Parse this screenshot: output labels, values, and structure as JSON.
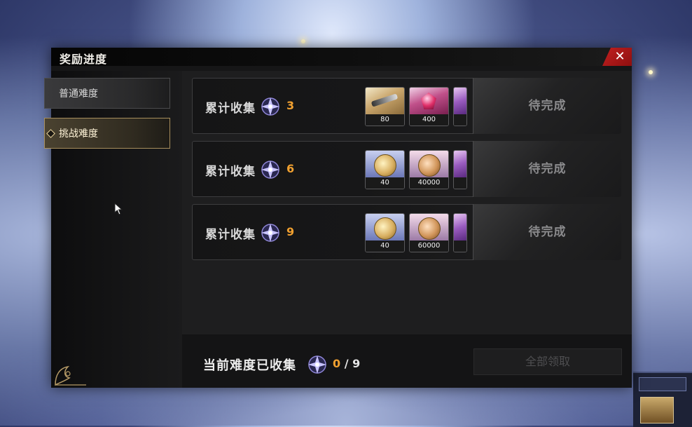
{
  "panel": {
    "title": "奖励进度",
    "close_label": "✕"
  },
  "sidebar": {
    "items": [
      {
        "label": "普通难度",
        "active": false
      },
      {
        "label": "挑战难度",
        "active": true
      }
    ]
  },
  "rows": [
    {
      "label": "累计收集",
      "count": "3",
      "items": [
        {
          "qty": "80",
          "icon": "sword"
        },
        {
          "qty": "400",
          "icon": "gem"
        },
        {
          "qty": "",
          "icon": "purple-item"
        }
      ],
      "status": "待完成"
    },
    {
      "label": "累计收集",
      "count": "6",
      "items": [
        {
          "qty": "40",
          "icon": "gold-coin"
        },
        {
          "qty": "40000",
          "icon": "copper-coin"
        },
        {
          "qty": "",
          "icon": "purple-item"
        }
      ],
      "status": "待完成"
    },
    {
      "label": "累计收集",
      "count": "9",
      "items": [
        {
          "qty": "40",
          "icon": "gold-coin"
        },
        {
          "qty": "60000",
          "icon": "copper-coin"
        },
        {
          "qty": "",
          "icon": "purple-item"
        }
      ],
      "status": "待完成"
    }
  ],
  "footer": {
    "label": "当前难度已收集",
    "current": "0",
    "separator": "/",
    "total": "9",
    "claim_all": "全部领取"
  },
  "colors": {
    "accent_orange": "#f0a030",
    "close_red": "#c22020",
    "active_gold": "#a88f5d"
  }
}
